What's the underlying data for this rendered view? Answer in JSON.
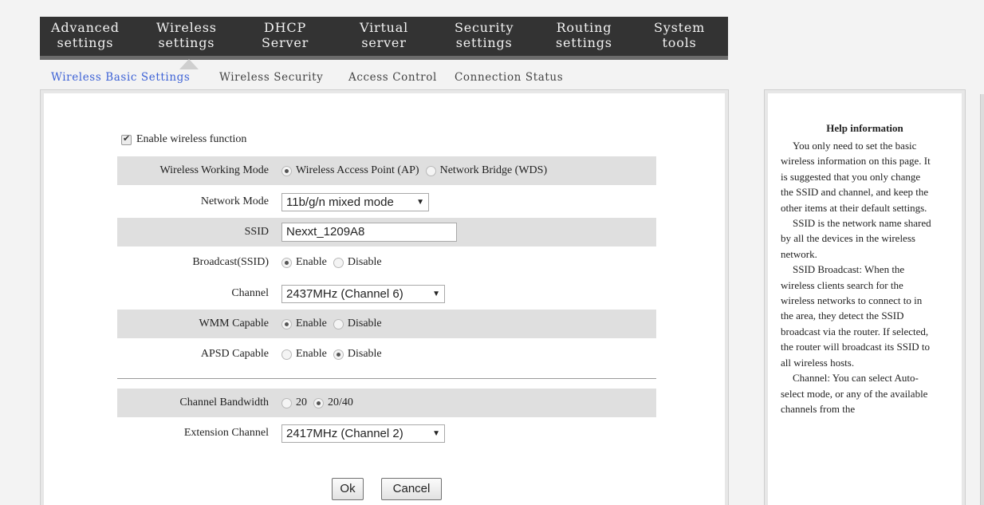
{
  "topnav": {
    "items": [
      {
        "line1": "Advanced",
        "line2": "settings"
      },
      {
        "line1": "Wireless",
        "line2": "settings"
      },
      {
        "line1": "DHCP",
        "line2": "Server"
      },
      {
        "line1": "Virtual",
        "line2": "server"
      },
      {
        "line1": "Security",
        "line2": "settings"
      },
      {
        "line1": "Routing",
        "line2": "settings"
      },
      {
        "line1": "System",
        "line2": "tools"
      }
    ]
  },
  "subnav": {
    "items": [
      "Wireless Basic Settings",
      "Wireless Security",
      "Access Control",
      "Connection Status"
    ]
  },
  "form": {
    "enable_wireless_label": "Enable wireless function",
    "working_mode": {
      "label": "Wireless Working Mode",
      "opt_ap": "Wireless Access Point (AP)",
      "opt_wds": "Network Bridge (WDS)"
    },
    "network_mode": {
      "label": "Network Mode",
      "value": "11b/g/n mixed mode"
    },
    "ssid": {
      "label": "SSID",
      "value": "Nexxt_1209A8"
    },
    "broadcast": {
      "label": "Broadcast(SSID)",
      "opt_enable": "Enable",
      "opt_disable": "Disable"
    },
    "channel": {
      "label": "Channel",
      "value": "2437MHz (Channel 6)"
    },
    "wmm": {
      "label": "WMM Capable",
      "opt_enable": "Enable",
      "opt_disable": "Disable"
    },
    "apsd": {
      "label": "APSD Capable",
      "opt_enable": "Enable",
      "opt_disable": "Disable"
    },
    "bandwidth": {
      "label": "Channel Bandwidth",
      "opt_20": "20",
      "opt_2040": "20/40"
    },
    "extension": {
      "label": "Extension Channel",
      "value": "2417MHz (Channel 2)"
    },
    "ok_label": "Ok",
    "cancel_label": "Cancel"
  },
  "help": {
    "title": "Help information",
    "paragraphs": [
      "You only need to set the basic wireless information on this page. It is suggested that you only change the SSID and channel, and keep the other items at their default settings.",
      "SSID is the network name shared by all the devices in the wireless network.",
      "SSID Broadcast: When the wireless clients search for the wireless networks to connect to in the area, they detect the SSID broadcast via the router. If selected, the router will broadcast its SSID to all wireless hosts.",
      "Channel: You can select Auto-select mode, or any of the available channels from the"
    ]
  }
}
